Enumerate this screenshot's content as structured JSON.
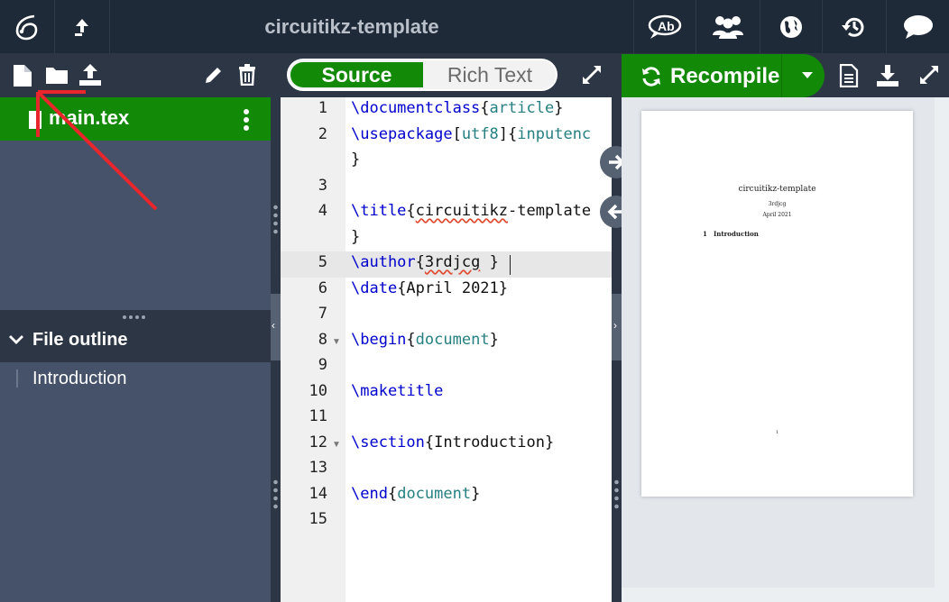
{
  "header": {
    "project_title": "circuitikz-template"
  },
  "file_tree": {
    "files": [
      {
        "name": "main.tex",
        "selected": true
      }
    ]
  },
  "outline": {
    "title": "File outline",
    "items": [
      "Introduction"
    ]
  },
  "editor": {
    "mode_source": "Source",
    "mode_rich": "Rich Text",
    "line_numbers": [
      "1",
      "2",
      "3",
      "4",
      "5",
      "6",
      "7",
      "8",
      "9",
      "10",
      "11",
      "12",
      "13",
      "14",
      "15"
    ],
    "active_line": 5
  },
  "compile": {
    "recompile_label": "Recompile"
  },
  "pdf_preview": {
    "title": "circuitikz-template",
    "author": "3rdjcg",
    "date": "April 2021",
    "section_number": "1",
    "section_title": "Introduction",
    "page_number": "1"
  },
  "colors": {
    "accent_green": "#138a07",
    "topbar": "#1f2a38",
    "panel": "#2c3645"
  },
  "icons": [
    "overleaf-logo-icon",
    "up-arrow-icon",
    "review-icon",
    "share-icon",
    "publish-icon",
    "history-icon",
    "chat-icon",
    "new-file-icon",
    "new-folder-icon",
    "upload-icon",
    "rename-icon",
    "delete-icon",
    "file-menu-icon",
    "expand-icon",
    "refresh-icon",
    "download-pdf-icon",
    "logs-icon"
  ]
}
